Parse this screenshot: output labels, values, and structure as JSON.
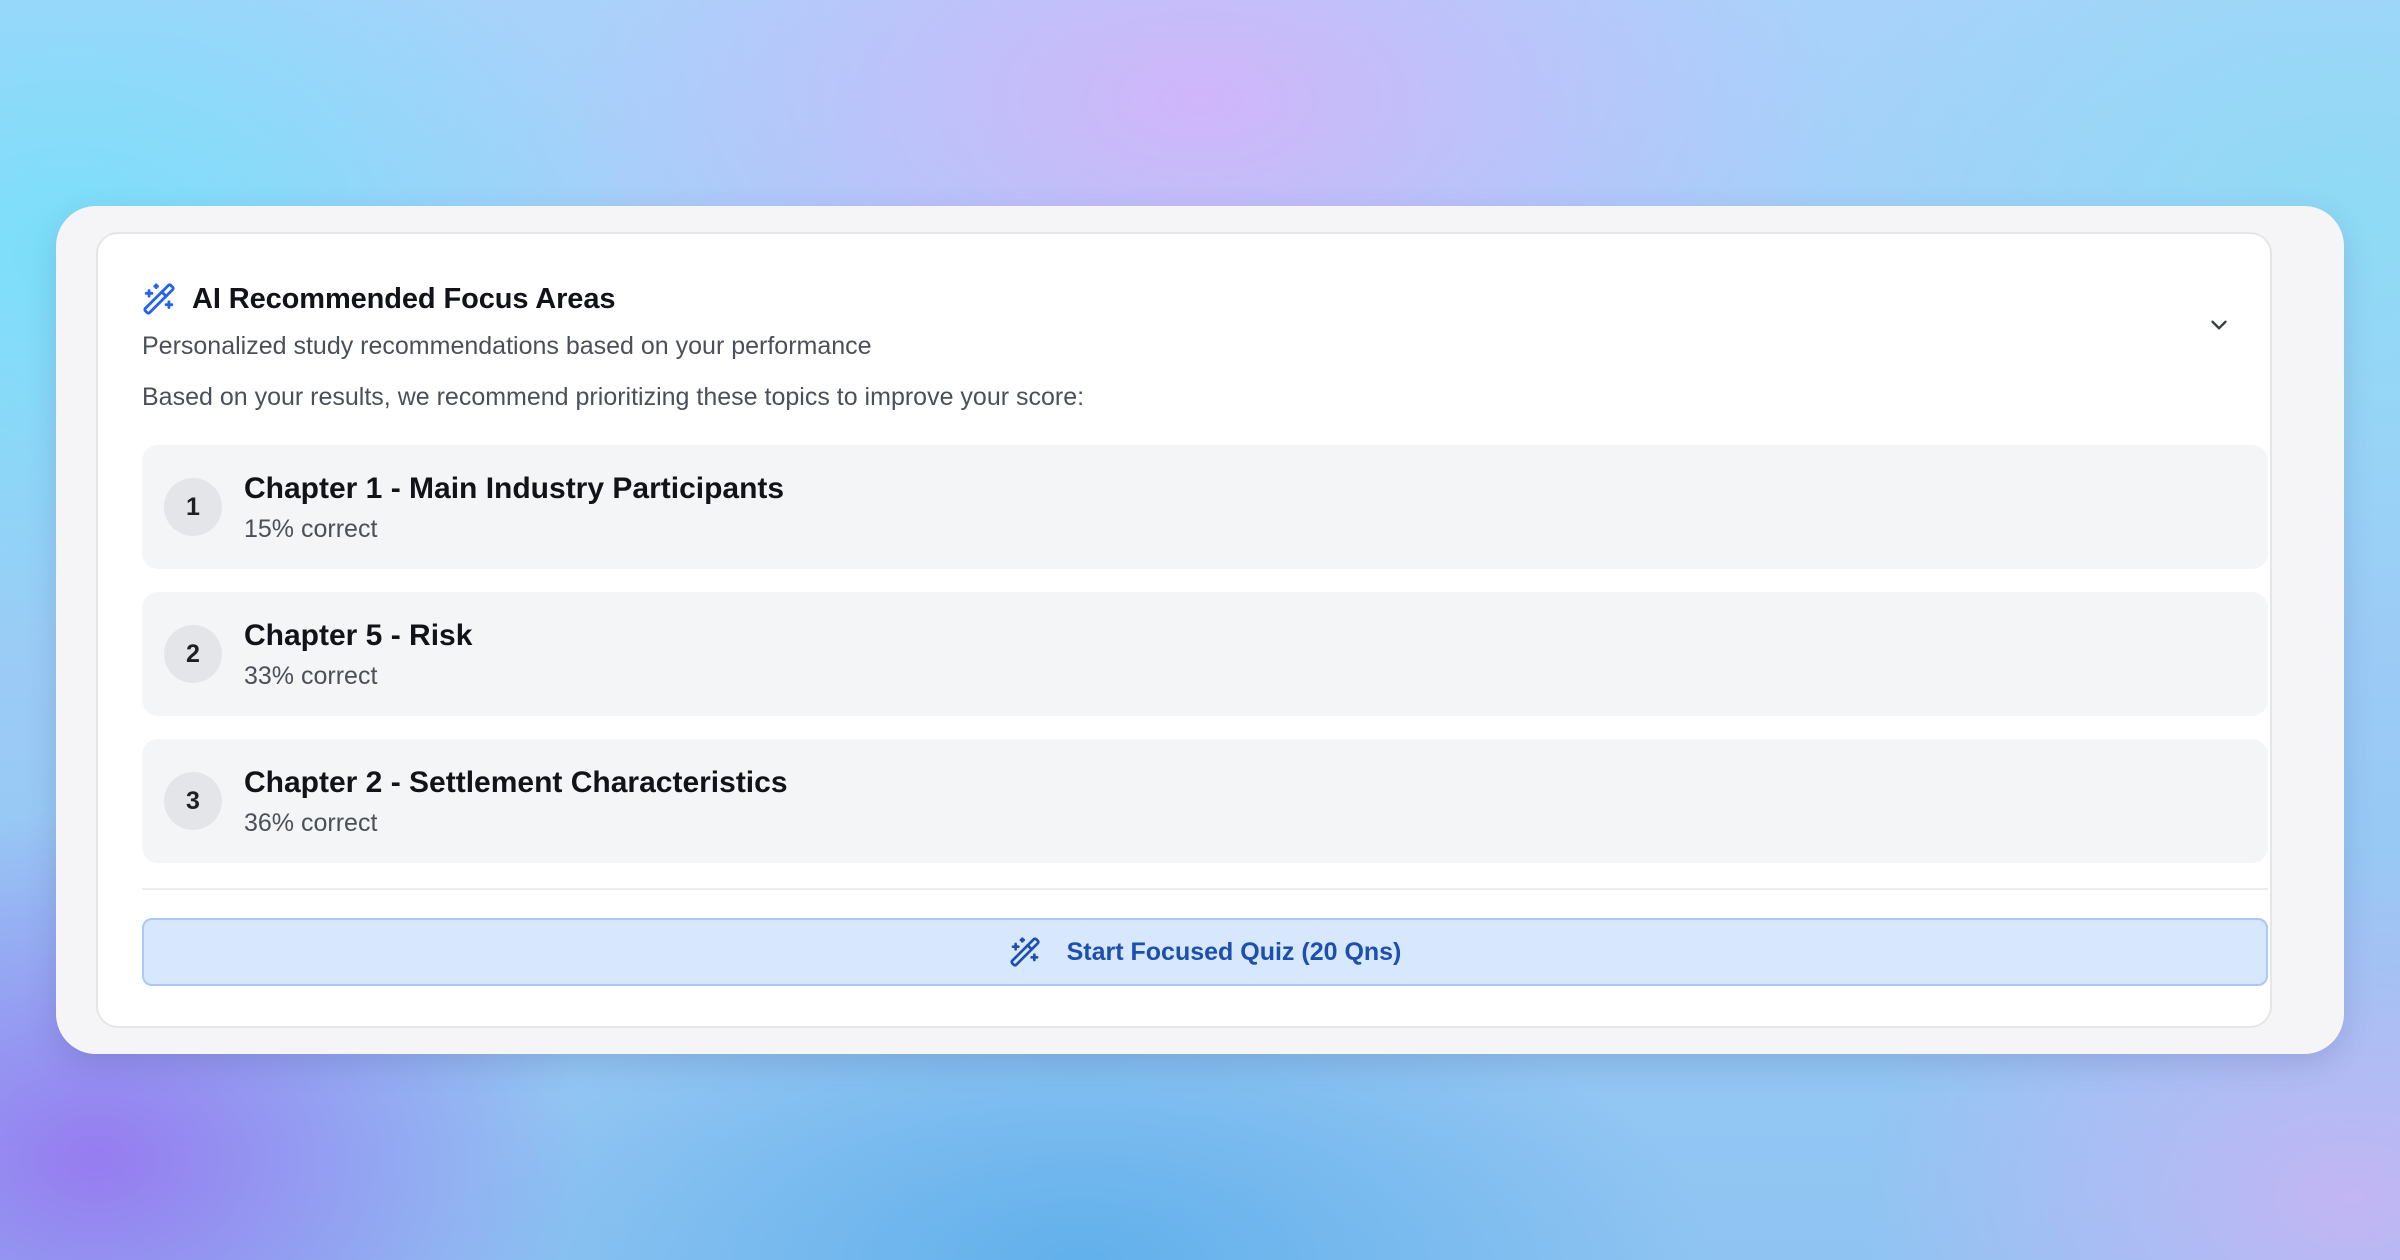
{
  "colors": {
    "accent": "#2563eb",
    "button_bg": "#d7e7fd",
    "button_text": "#1d4fae"
  },
  "header": {
    "icon": "magic-wand-icon",
    "title": "AI Recommended Focus Areas",
    "subtitle": "Personalized study recommendations based on your performance",
    "collapse_icon": "chevron-down-icon"
  },
  "intro": "Based on your results, we recommend prioritizing these topics to improve your score:",
  "topics": [
    {
      "rank": "1",
      "name": "Chapter 1 - Main Industry Participants",
      "score": "15% correct"
    },
    {
      "rank": "2",
      "name": "Chapter 5 - Risk",
      "score": "33% correct"
    },
    {
      "rank": "3",
      "name": "Chapter 2 - Settlement Characteristics",
      "score": "36% correct"
    }
  ],
  "action": {
    "icon": "magic-wand-icon",
    "label": "Start Focused Quiz (20 Qns)"
  }
}
